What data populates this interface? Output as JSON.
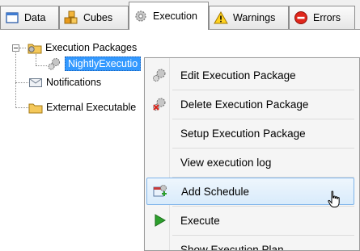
{
  "tabs": [
    {
      "label": "Data",
      "icon": "table-icon",
      "active": false
    },
    {
      "label": "Cubes",
      "icon": "cubes-icon",
      "active": false
    },
    {
      "label": "Execution",
      "icon": "gear-icon",
      "active": true
    },
    {
      "label": "Warnings",
      "icon": "warning-icon",
      "active": false
    },
    {
      "label": "Errors",
      "icon": "error-icon",
      "active": false
    }
  ],
  "tree": {
    "root": {
      "label": "Execution Packages",
      "icon": "package-folder-icon",
      "expanded": true
    },
    "child": {
      "label": "NightlyExecutio",
      "icon": "gears-icon",
      "selected": true
    },
    "notifications": {
      "label": "Notifications",
      "icon": "envelope-icon"
    },
    "external": {
      "label": "External Executable",
      "icon": "folder-icon"
    }
  },
  "context_menu": {
    "items": [
      {
        "label": "Edit Execution Package",
        "icon": "edit-gear-icon"
      },
      {
        "label": "Delete Execution Package",
        "icon": "delete-gear-icon"
      },
      {
        "label": "Setup Execution Package",
        "icon": ""
      },
      {
        "label": "View execution log",
        "icon": ""
      },
      {
        "label": "Add Schedule",
        "icon": "add-schedule-icon",
        "hover": true
      },
      {
        "label": "Execute",
        "icon": "play-icon"
      },
      {
        "label": "Show Execution Plan",
        "icon": ""
      }
    ]
  },
  "colors": {
    "selection": "#3399ff",
    "menu_hover": "#d9ebfb",
    "menu_hover_border": "#7eb4ea",
    "play_green": "#2ca02c"
  }
}
